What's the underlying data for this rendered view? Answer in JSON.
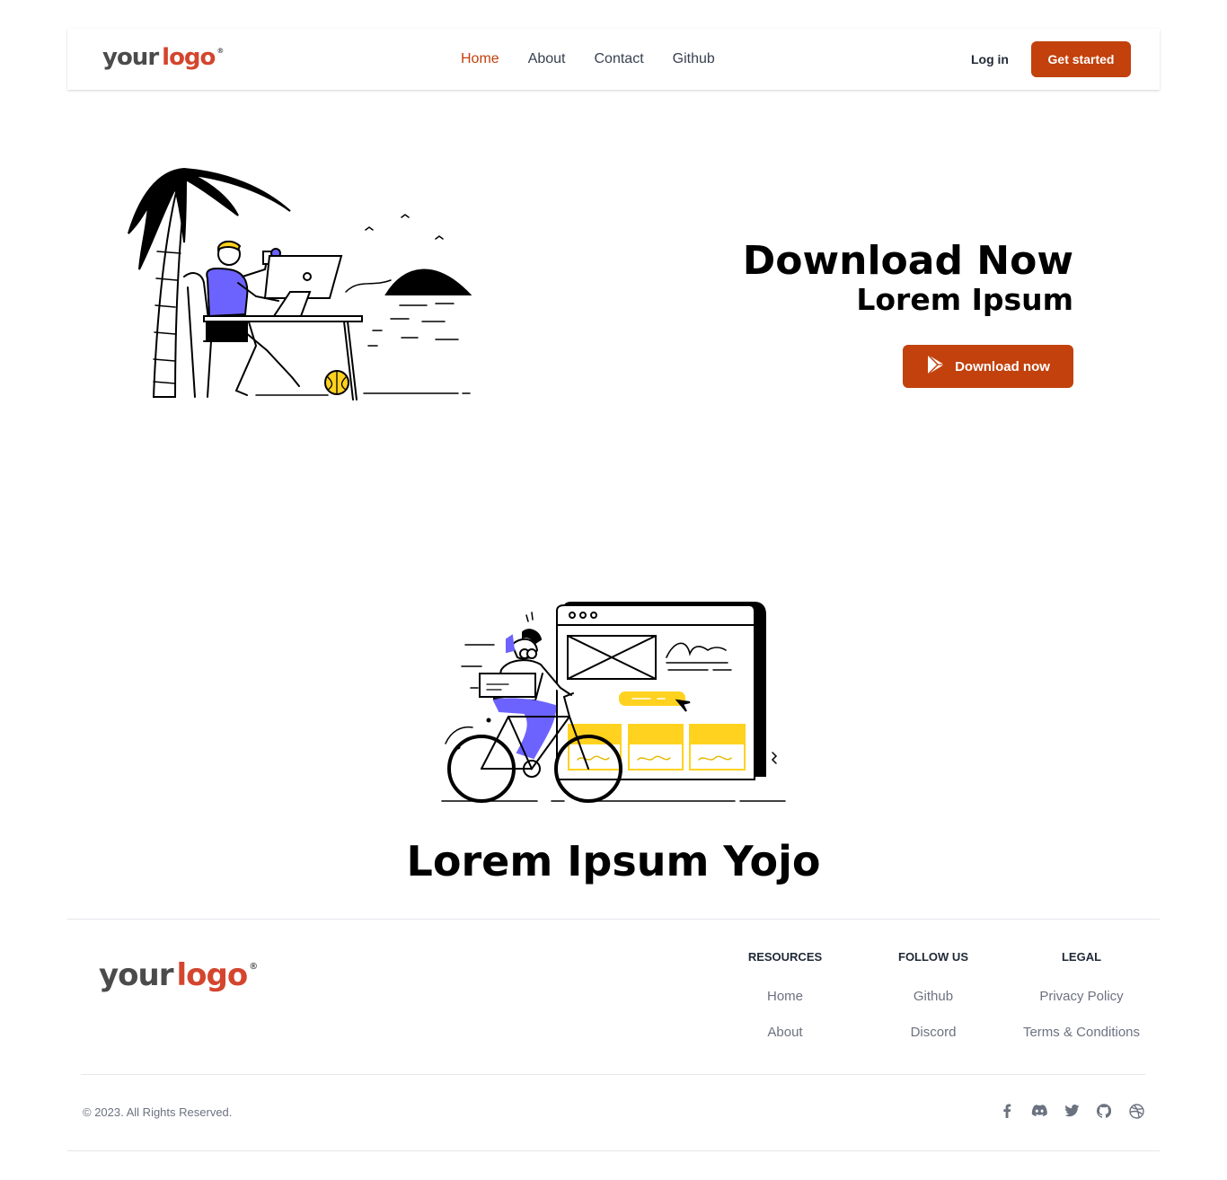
{
  "brand": {
    "logo_your": "your",
    "logo_logo": "logo",
    "logo_reg": "®",
    "accent": "#c2410c",
    "logo_color": "#d4452e"
  },
  "nav": {
    "links": [
      {
        "label": "Home",
        "active": true
      },
      {
        "label": "About"
      },
      {
        "label": "Contact"
      },
      {
        "label": "Github"
      }
    ],
    "login_label": "Log in",
    "cta_label": "Get started"
  },
  "hero": {
    "title": "Download Now",
    "subtitle": "Lorem Ipsum",
    "button_label": "Download now",
    "button_icon": "play-store-icon",
    "illustration": "person-working-on-laptop-at-beach-illustration"
  },
  "section2": {
    "illustration": "person-riding-bicycle-illustration",
    "title": "Lorem Ipsum Yojo"
  },
  "footer": {
    "columns": [
      {
        "heading": "RESOURCES",
        "links": [
          "Home",
          "About"
        ]
      },
      {
        "heading": "FOLLOW US",
        "links": [
          "Github",
          "Discord"
        ]
      },
      {
        "heading": "LEGAL",
        "links": [
          "Privacy Policy",
          "Terms & Conditions"
        ]
      }
    ],
    "copyright": "© 2023. All Rights Reserved.",
    "socials": [
      "facebook-icon",
      "discord-icon",
      "twitter-icon",
      "github-icon",
      "dribbble-icon"
    ]
  }
}
